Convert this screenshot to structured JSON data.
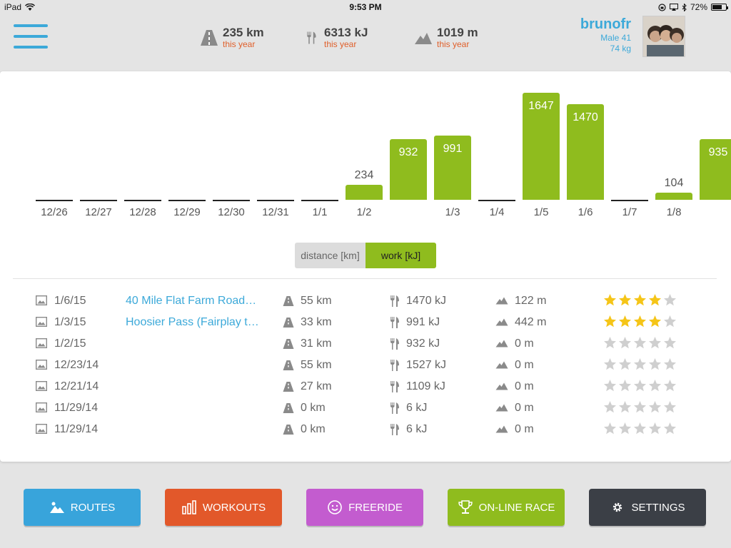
{
  "status_bar": {
    "device": "iPad",
    "time": "9:53 PM",
    "battery": "72%",
    "battery_level": 0.72
  },
  "header": {
    "stats": [
      {
        "value": "235 km",
        "sub": "this year",
        "icon": "road-icon"
      },
      {
        "value": "6313 kJ",
        "sub": "this year",
        "icon": "fork-knife-icon"
      },
      {
        "value": "1019 m",
        "sub": "this year",
        "icon": "mountain-icon"
      }
    ],
    "user": {
      "name": "brunofr",
      "gender_age": "Male 41",
      "weight": "74 kg"
    }
  },
  "chart_data": {
    "type": "bar",
    "categories": [
      "12/26",
      "12/27",
      "12/28",
      "12/29",
      "12/30",
      "12/31",
      "1/1",
      "1/2",
      "",
      "1/3",
      "1/4",
      "1/5",
      "1/6",
      "1/7",
      "1/8",
      ""
    ],
    "values": [
      0,
      0,
      0,
      0,
      0,
      0,
      0,
      234,
      932,
      991,
      0,
      1647,
      1470,
      0,
      104,
      935
    ],
    "ylabel": "",
    "series_name": "work [kJ]"
  },
  "toggle": {
    "distance_label": "distance [km]",
    "work_label": "work [kJ]",
    "selected": "work"
  },
  "activities": [
    {
      "date": "1/6/15",
      "name": "40 Mile Flat Farm Road…",
      "distance": "55 km",
      "work": "1470 kJ",
      "elevation": "122 m",
      "rating": 4
    },
    {
      "date": "1/3/15",
      "name": "Hoosier Pass (Fairplay t…",
      "distance": "33 km",
      "work": "991 kJ",
      "elevation": "442 m",
      "rating": 4
    },
    {
      "date": "1/2/15",
      "name": "",
      "distance": "31 km",
      "work": "932 kJ",
      "elevation": "0 m",
      "rating": 0
    },
    {
      "date": "12/23/14",
      "name": "",
      "distance": "55 km",
      "work": "1527 kJ",
      "elevation": "0 m",
      "rating": 0
    },
    {
      "date": "12/21/14",
      "name": "",
      "distance": "27 km",
      "work": "1109 kJ",
      "elevation": "0 m",
      "rating": 0
    },
    {
      "date": "11/29/14",
      "name": "",
      "distance": "0 km",
      "work": "6 kJ",
      "elevation": "0 m",
      "rating": 0
    },
    {
      "date": "11/29/14",
      "name": "",
      "distance": "0 km",
      "work": "6 kJ",
      "elevation": "0 m",
      "rating": 0
    }
  ],
  "nav": {
    "routes": "ROUTES",
    "workouts": "WORKOUTS",
    "freeride": "FREERIDE",
    "online_race": "ON-LINE RACE",
    "settings": "SETTINGS"
  },
  "colors": {
    "accent_blue": "#3ca9d9",
    "bar_green": "#8fbc1e",
    "sub_orange": "#e05f2a",
    "routes": "#38a4db",
    "workouts": "#e2582a",
    "freeride": "#c35ccf",
    "online_race": "#8fbc1e",
    "settings": "#3b3f46",
    "star_on": "#f5c518",
    "star_off": "#cfcfcf"
  }
}
